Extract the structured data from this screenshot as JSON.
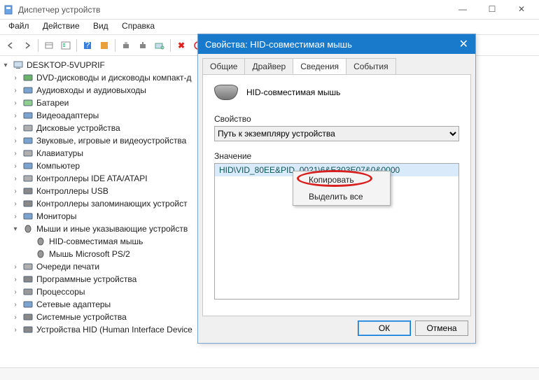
{
  "window": {
    "title": "Диспетчер устройств",
    "menus": [
      "Файл",
      "Действие",
      "Вид",
      "Справка"
    ]
  },
  "tree": {
    "root": "DESKTOP-5VUPRIF",
    "nodes": [
      {
        "label": "DVD-дисководы и дисководы компакт-д"
      },
      {
        "label": "Аудиовходы и аудиовыходы"
      },
      {
        "label": "Батареи"
      },
      {
        "label": "Видеоадаптеры"
      },
      {
        "label": "Дисковые устройства"
      },
      {
        "label": "Звуковые, игровые и видеоустройства"
      },
      {
        "label": "Клавиатуры"
      },
      {
        "label": "Компьютер"
      },
      {
        "label": "Контроллеры IDE ATA/ATAPI"
      },
      {
        "label": "Контроллеры USB"
      },
      {
        "label": "Контроллеры запоминающих устройст"
      },
      {
        "label": "Мониторы"
      },
      {
        "label": "Мыши и иные указывающие устройств",
        "expanded": true,
        "children": [
          {
            "label": "HID-совместимая мышь"
          },
          {
            "label": "Мышь Microsoft PS/2"
          }
        ]
      },
      {
        "label": "Очереди печати"
      },
      {
        "label": "Программные устройства"
      },
      {
        "label": "Процессоры"
      },
      {
        "label": "Сетевые адаптеры"
      },
      {
        "label": "Системные устройства"
      },
      {
        "label": "Устройства HID (Human Interface Device"
      }
    ]
  },
  "dialog": {
    "title": "Свойства: HID-совместимая мышь",
    "tabs": [
      "Общие",
      "Драйвер",
      "Сведения",
      "События"
    ],
    "activeTab": 2,
    "deviceName": "HID-совместимая мышь",
    "propLabel": "Свойство",
    "propValue": "Путь к экземпляру устройства",
    "valLabel": "Значение",
    "value": "HID\\VID_80EE&PID_0021\\6&E303E07&0&0000",
    "ok": "ОК",
    "cancel": "Отмена"
  },
  "context": {
    "items": [
      "Копировать",
      "Выделить все"
    ]
  }
}
